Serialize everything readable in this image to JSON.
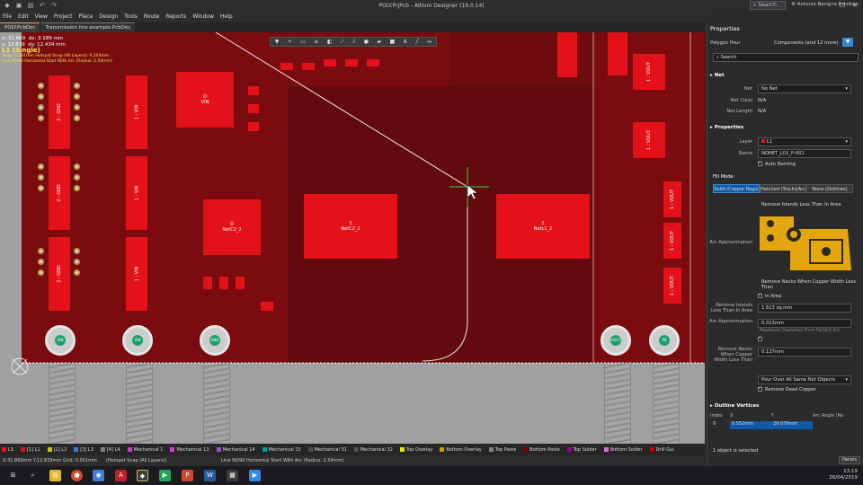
{
  "window": {
    "title": "POLY.PrjPcb - Altium Designer (19.0.14)",
    "search_label": "Search",
    "user": "Antonio Becerra Esteban"
  },
  "menu": [
    "File",
    "Edit",
    "View",
    "Project",
    "Place",
    "Design",
    "Tools",
    "Route",
    "Reports",
    "Window",
    "Help"
  ],
  "doc_tabs": [
    {
      "label": "POLY.PcbDoc",
      "active": true
    },
    {
      "label": "Transmission line example.PcbDoc",
      "active": false
    }
  ],
  "hud": {
    "x": "x: 31.869",
    "dx": "dx: 3.189 mm",
    "y": "y: 12.839",
    "dy": "dy: 12.434 mm",
    "layer": "L1 (Single)",
    "snap": "Snap: 0.001mm Hotspot Snap (All Layers): 0.203mm",
    "mode": "Line 90/90 Horizontal Start With Arc (Radius: 2.54mm)"
  },
  "toolbar": [
    "filter-icon",
    "plus-icon",
    "rect-icon",
    "align-icon",
    "place-icon",
    "route-icon",
    "diffpair-icon",
    "bulb-icon",
    "poly-icon",
    "fill-icon",
    "text-icon",
    "line-icon",
    "dim-icon"
  ],
  "pads": {
    "gnd1": "2 : GND",
    "gnd2": "2 : GND",
    "gnd3": "2 : GND",
    "vin1": "1 : VIN",
    "vin2": "1 : VIN",
    "vin3": "1 : VIN",
    "d_vin_num": "D",
    "d_vin": "VIN",
    "netc2_2_small_num": "D",
    "netc2_2_small": "NetC2_2",
    "netc2_2_num": "1",
    "netc2_2": "NetC2_2",
    "netl1_2_num": "2",
    "netl1_2": "NetL1_2",
    "vout1": "1 : VOUT",
    "vout2": "1 : VOUT",
    "vout3": "1 : VOUT",
    "vout4": "1 : VOUT",
    "vout5": "1 : VOUT"
  },
  "holes": [
    "VIN",
    "VIN",
    "GND",
    "VOUT",
    "P8"
  ],
  "layers": [
    {
      "name": "LS",
      "color": "#e3121a"
    },
    {
      "name": "[1] L1",
      "color": "#e3121a"
    },
    {
      "name": "[2] L2",
      "color": "#c8c800"
    },
    {
      "name": "[3] L3",
      "color": "#2f7fd6"
    },
    {
      "name": "[4] L4",
      "color": "#7f7f7f"
    },
    {
      "name": "Mechanical 1",
      "color": "#d63ad6"
    },
    {
      "name": "Mechanical 13",
      "color": "#d63ad6"
    },
    {
      "name": "Mechanical 14",
      "color": "#a050d0"
    },
    {
      "name": "Mechanical 15",
      "color": "#00a0a0"
    },
    {
      "name": "Mechanical 31",
      "color": "#505050"
    },
    {
      "name": "Mechanical 32",
      "color": "#505050"
    },
    {
      "name": "Top Overlay",
      "color": "#e6e600"
    },
    {
      "name": "Bottom Overlay",
      "color": "#c8a000"
    },
    {
      "name": "Top Paste",
      "color": "#808080"
    },
    {
      "name": "Bottom Paste",
      "color": "#800000"
    },
    {
      "name": "Top Solder",
      "color": "#a000a0"
    },
    {
      "name": "Bottom Solder",
      "color": "#d070d0"
    },
    {
      "name": "Drill Gui",
      "color": "#c00000"
    }
  ],
  "status": {
    "coords": "X:31.869mm Y:12.839mm",
    "grid": "Grid: 0.001mm",
    "snap": "(Hotspot Snap (All Layers))",
    "mode": "Line 90/90 Horizontal Start With Arc (Radius: 2.54mm)",
    "panels": "Panels"
  },
  "panel": {
    "title": "Properties",
    "object_type": "Polygon Pour",
    "filter": "Components (and 12 more)",
    "search_placeholder": "Search",
    "net_section": "Net",
    "net_label": "Net",
    "net_value": "No Net",
    "net_class_label": "Net Class",
    "net_class_value": "N/A",
    "net_length_label": "Net Length",
    "net_length_value": "N/A",
    "properties_section": "Properties",
    "layer_label": "Layer",
    "layer_value": "L1",
    "name_label": "Name",
    "name_value": "NONET_L01_P-001",
    "auto_naming": "Auto Naming",
    "fill_mode": "Fill Mode",
    "fill_options": [
      "Solid (Copper Regio",
      "Hatched (Tracks/Arc",
      "None (Outlines)"
    ],
    "remove_islands_hdr": "Remove Islands Less Than In Area",
    "arc_approx_label": "Arc Approximation",
    "remove_necks_hdr": "Remove Necks When Copper Width Less Than",
    "in_area": "In Area",
    "remove_islands_label": "Remove Islands Less Than In Area",
    "remove_islands_value": "1.613 sq.mm",
    "arc_approx_label2": "Arc Approximation",
    "arc_approx_value": "0.013mm",
    "arc_approx_note": "Maximum Deviation From Perfect Arc",
    "remove_necks_label": "Remove Necks When Copper Width Less Than",
    "remove_necks_value": "0.127mm",
    "pour_over": "Pour Over All Same Net Objects",
    "remove_dead": "Remove Dead Copper",
    "outline_section": "Outline Vertices",
    "vertex_headers": [
      "Index",
      "X",
      "Y",
      "Arc Angle (Ne"
    ],
    "vertex_row": [
      "0",
      "5.552mm",
      "29.076mm",
      ""
    ],
    "selection": "1 object is selected"
  },
  "clock": {
    "time": "13:19",
    "date": "26/04/2019"
  }
}
